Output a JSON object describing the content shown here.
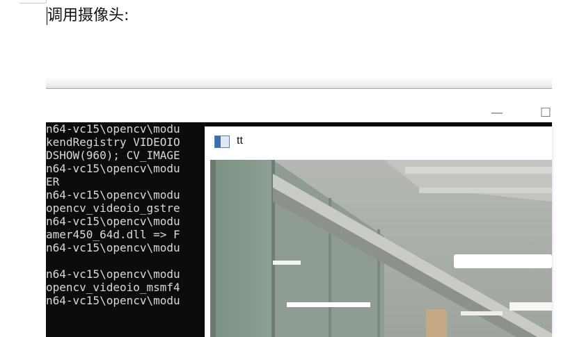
{
  "document": {
    "heading": "调用摄像头:"
  },
  "console_window": {
    "minimize_glyph": "—",
    "maximize_glyph": "☐",
    "lines": [
      "n64-vc15\\opencv\\modu",
      "kendRegistry VIDEOIO",
      "DSHOW(960); CV_IMAGE",
      "n64-vc15\\opencv\\modu",
      "ER",
      "n64-vc15\\opencv\\modu",
      "opencv_videoio_gstre",
      "n64-vc15\\opencv\\modu",
      "amer450_64d.dll => F",
      "n64-vc15\\opencv\\modu",
      "",
      "n64-vc15\\opencv\\modu",
      "opencv_videoio_msmf4",
      "n64-vc15\\opencv\\modu"
    ]
  },
  "camera_window": {
    "title": "tt",
    "icon": "app-window-icon"
  },
  "colors": {
    "console_bg": "#0c0c0c",
    "console_text": "#d9d9d9",
    "camera_ceiling": "#a7aba5"
  }
}
